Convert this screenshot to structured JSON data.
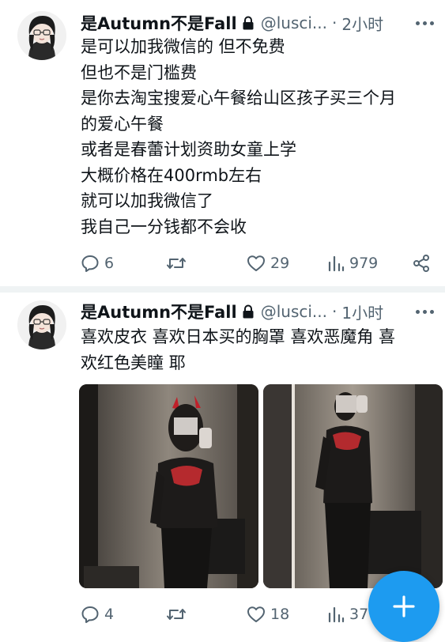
{
  "tweets": [
    {
      "author": {
        "name": "是Autumn不是Fall",
        "handle": "@lusci...",
        "locked": true
      },
      "time": "2小时",
      "lines": [
        "是可以加我微信的 但不免费",
        "但也不是门槛费",
        "是你去淘宝搜爱心午餐给山区孩子买三个月",
        "的爱心午餐",
        "或者是春蕾计划资助女童上学",
        "大概价格在400rmb左右",
        "就可以加我微信了",
        "我自己一分钱都不会收"
      ],
      "stats": {
        "replies": "6",
        "retweets": "",
        "likes": "29",
        "views": "979"
      }
    },
    {
      "author": {
        "name": "是Autumn不是Fall",
        "handle": "@lusci...",
        "locked": true
      },
      "time": "1小时",
      "lines": [
        "喜欢皮衣 喜欢日本买的胸罩 喜欢恶魔角 喜",
        "欢红色美瞳 耶"
      ],
      "stats": {
        "replies": "4",
        "retweets": "",
        "likes": "18",
        "views": "37"
      }
    }
  ],
  "colors": {
    "accent": "#1d9bf0",
    "secondary_text": "#536471",
    "divider": "#eff3f4"
  },
  "icons": [
    "lock-icon",
    "more-icon",
    "reply-icon",
    "retweet-icon",
    "like-icon",
    "views-icon",
    "share-icon",
    "plus-icon"
  ]
}
